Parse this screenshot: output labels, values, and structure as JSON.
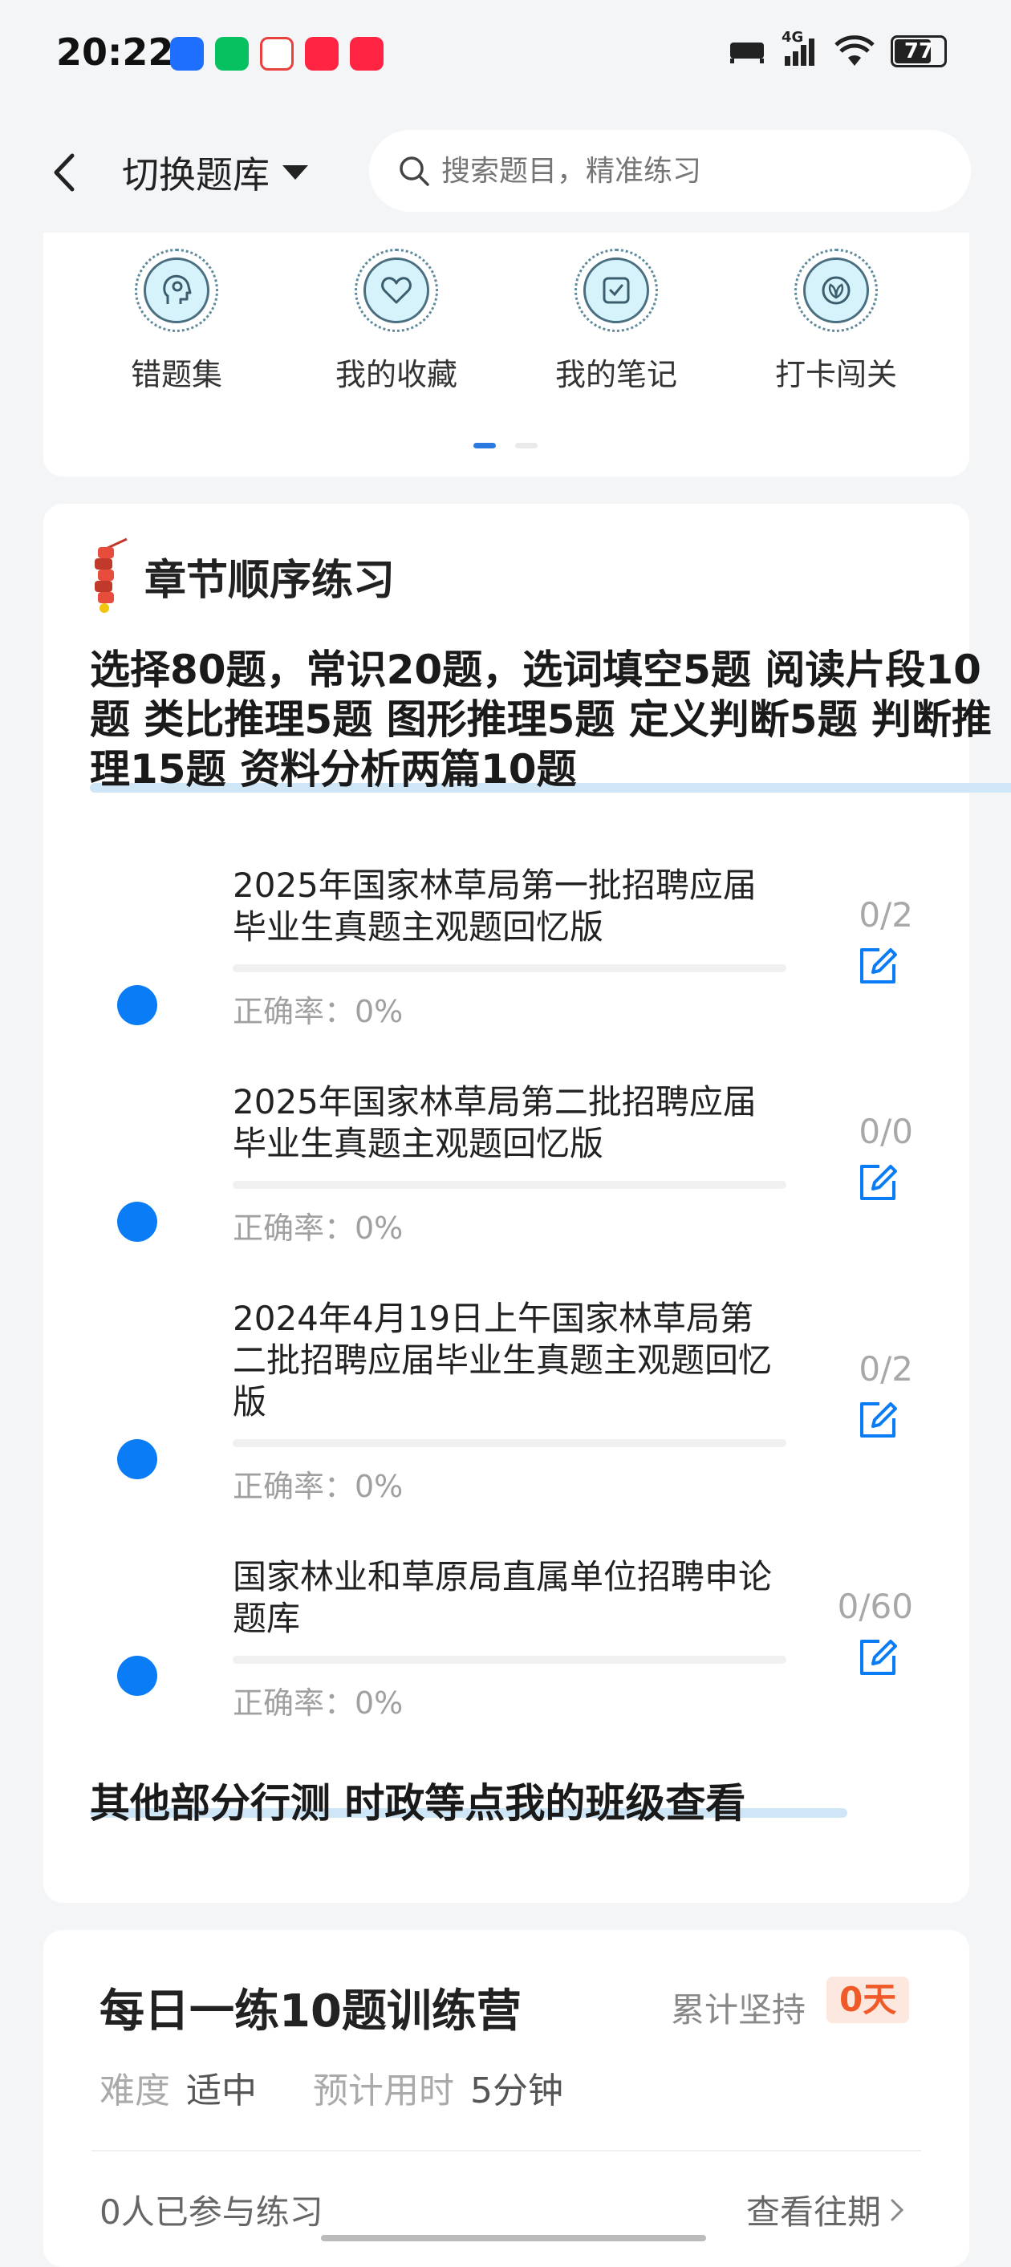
{
  "status_bar": {
    "time": "20:22",
    "network": "4G",
    "battery": "77",
    "battery_level": 0.77,
    "app_icons": [
      "app-icon-blue",
      "wechat-icon",
      "app-icon-red-triangle",
      "xiaohongshu-icon",
      "xiaohongshu-icon"
    ],
    "app_colors": [
      "#1f6fff",
      "#07c160",
      "#e9413b",
      "#ff2442",
      "#ff2442"
    ]
  },
  "header": {
    "switch_label": "切换题库",
    "search_placeholder": "搜索题目，精准练习"
  },
  "quick_actions": [
    {
      "label": "错题集",
      "icon": "head-icon"
    },
    {
      "label": "我的收藏",
      "icon": "heart-icon"
    },
    {
      "label": "我的笔记",
      "icon": "note-check-icon"
    },
    {
      "label": "打卡闯关",
      "icon": "leaf-icon"
    }
  ],
  "chapter": {
    "title": "章节顺序练习",
    "description": "选择80题，常识20题，选词填空5题 阅读片段10题 类比推理5题 图形推理5题 定义判断5题 判断推理15题 资料分析两篇10题",
    "items": [
      {
        "name": "2025年国家林草局第一批招聘应届毕业生真题主观题回忆版",
        "accuracy": "正确率：0%",
        "count": "0/2",
        "progress": 0
      },
      {
        "name": "2025年国家林草局第二批招聘应届毕业生真题主观题回忆版",
        "accuracy": "正确率：0%",
        "count": "0/0",
        "progress": 0
      },
      {
        "name": "2024年4月19日上午国家林草局第二批招聘应届毕业生真题主观题回忆版",
        "accuracy": "正确率：0%",
        "count": "0/2",
        "progress": 0
      },
      {
        "name": "国家林业和草原局直属单位招聘申论题库",
        "accuracy": "正确率：0%",
        "count": "0/60",
        "progress": 0
      }
    ],
    "other_link": "其他部分行测 时政等点我的班级查看"
  },
  "daily": {
    "title": "每日一练10题训练营",
    "persist_label": "累计坚持",
    "persist_value": "0天",
    "difficulty_label": "难度",
    "difficulty_value": "适中",
    "time_label": "预计用时",
    "time_value": "5分钟",
    "participants": "0人已参与练习",
    "view_past": "查看往期"
  },
  "colors": {
    "accent": "#0a7cf5",
    "badge_bg": "#fde8df",
    "badge_text": "#f05a28",
    "highlight": "#cfe6f7"
  }
}
